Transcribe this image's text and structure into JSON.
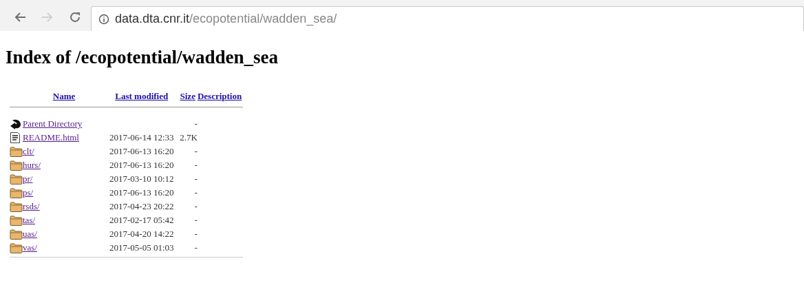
{
  "toolbar": {
    "url_host": "data.dta.cnr.it",
    "url_path": "/ecopotential/wadden_sea/"
  },
  "heading": "Index of /ecopotential/wadden_sea",
  "table": {
    "columns": [
      "Name",
      "Last modified",
      "Size",
      "Description"
    ],
    "rows": [
      {
        "kind": "parent",
        "name": "Parent Directory",
        "modified": "",
        "size": "-"
      },
      {
        "kind": "file",
        "name": "README.html",
        "modified": "2017-06-14 12:33",
        "size": "2.7K"
      },
      {
        "kind": "folder",
        "name": "clt/",
        "modified": "2017-06-13 16:20",
        "size": "-"
      },
      {
        "kind": "folder",
        "name": "hurs/",
        "modified": "2017-06-13 16:20",
        "size": "-"
      },
      {
        "kind": "folder",
        "name": "pr/",
        "modified": "2017-03-10 10:12",
        "size": "-"
      },
      {
        "kind": "folder",
        "name": "ps/",
        "modified": "2017-06-13 16:20",
        "size": "-"
      },
      {
        "kind": "folder",
        "name": "rsds/",
        "modified": "2017-04-23 20:22",
        "size": "-"
      },
      {
        "kind": "folder",
        "name": "tas/",
        "modified": "2017-02-17 05:42",
        "size": "-"
      },
      {
        "kind": "folder",
        "name": "uas/",
        "modified": "2017-04-20 14:22",
        "size": "-"
      },
      {
        "kind": "folder",
        "name": "vas/",
        "modified": "2017-05-05 01:03",
        "size": "-"
      }
    ]
  }
}
